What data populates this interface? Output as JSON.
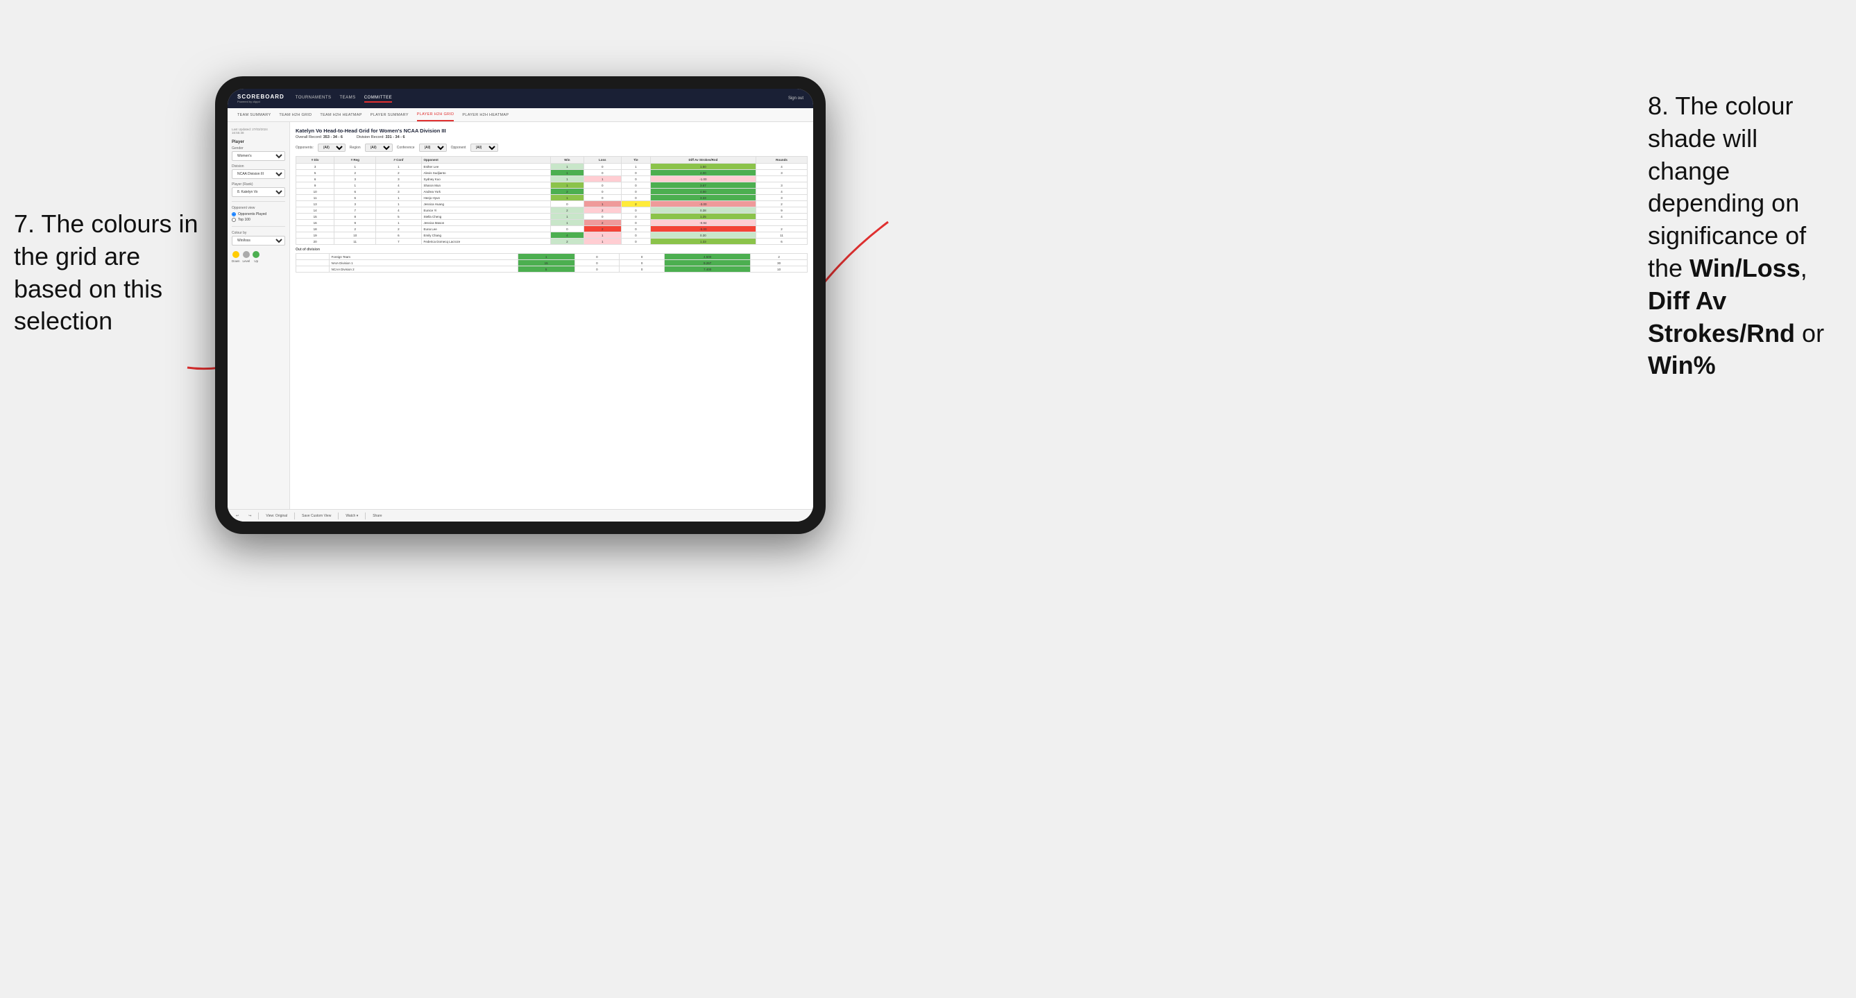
{
  "app": {
    "logo": "SCOREBOARD",
    "logo_sub": "Powered by clippd",
    "nav_links": [
      "TOURNAMENTS",
      "TEAMS",
      "COMMITTEE"
    ],
    "active_nav": "COMMITTEE",
    "sign_out": "Sign out",
    "sub_nav": [
      "TEAM SUMMARY",
      "TEAM H2H GRID",
      "TEAM H2H HEATMAP",
      "PLAYER SUMMARY",
      "PLAYER H2H GRID",
      "PLAYER H2H HEATMAP"
    ],
    "active_sub": "PLAYER H2H GRID"
  },
  "sidebar": {
    "last_updated_label": "Last Updated: 27/03/2024",
    "last_updated_time": "16:55:38",
    "player_section": "Player",
    "gender_label": "Gender",
    "gender_value": "Women's",
    "division_label": "Division",
    "division_value": "NCAA Division III",
    "player_rank_label": "Player (Rank)",
    "player_rank_value": "8. Katelyn Vo",
    "opponent_view_label": "Opponent view",
    "opponents_played_label": "Opponents Played",
    "top_100_label": "Top 100",
    "colour_by_label": "Colour by",
    "colour_by_value": "Win/loss",
    "colour_legend": [
      {
        "label": "Down",
        "color": "#ffcc00"
      },
      {
        "label": "Level",
        "color": "#aaaaaa"
      },
      {
        "label": "Up",
        "color": "#4caf50"
      }
    ]
  },
  "grid": {
    "title": "Katelyn Vo Head-to-Head Grid for Women's NCAA Division III",
    "overall_record_label": "Overall Record:",
    "overall_record": "353 - 34 - 6",
    "division_record_label": "Division Record:",
    "division_record": "331 - 34 - 6",
    "opponents_label": "Opponents:",
    "opponents_value": "(All)",
    "region_label": "Region",
    "conference_label": "Conference",
    "opponent_label": "Opponent",
    "columns": {
      "div": "# Div",
      "reg": "# Reg",
      "conf": "# Conf",
      "opponent": "Opponent",
      "win": "Win",
      "loss": "Loss",
      "tie": "Tie",
      "diff_av": "Diff Av Strokes/Rnd",
      "rounds": "Rounds"
    },
    "rows": [
      {
        "div": 3,
        "reg": 1,
        "conf": 1,
        "opponent": "Esther Lee",
        "win": 1,
        "loss": 0,
        "tie": 1,
        "diff_av": 1.5,
        "rounds": 4,
        "win_color": "green-light",
        "loss_color": "white",
        "tie_color": "white"
      },
      {
        "div": 5,
        "reg": 2,
        "conf": 2,
        "opponent": "Alexis Sudjianto",
        "win": 1,
        "loss": 0,
        "tie": 0,
        "diff_av": 4.0,
        "rounds": 3,
        "win_color": "green-dark",
        "loss_color": "white",
        "tie_color": "white"
      },
      {
        "div": 6,
        "reg": 3,
        "conf": 3,
        "opponent": "Sydney Kuo",
        "win": 1,
        "loss": 1,
        "tie": 0,
        "diff_av": -1.0,
        "rounds": null,
        "win_color": "green-light",
        "loss_color": "red-light",
        "tie_color": "white"
      },
      {
        "div": 9,
        "reg": 1,
        "conf": 4,
        "opponent": "Sharon Mun",
        "win": 1,
        "loss": 0,
        "tie": 0,
        "diff_av": 3.67,
        "rounds": 3,
        "win_color": "green-med",
        "loss_color": "white",
        "tie_color": "white"
      },
      {
        "div": 10,
        "reg": 6,
        "conf": 3,
        "opponent": "Andrea York",
        "win": 2,
        "loss": 0,
        "tie": 0,
        "diff_av": 4.0,
        "rounds": 4,
        "win_color": "green-dark",
        "loss_color": "white",
        "tie_color": "white"
      },
      {
        "div": 11,
        "reg": 6,
        "conf": 1,
        "opponent": "Heejo Hyun",
        "win": 1,
        "loss": 0,
        "tie": 0,
        "diff_av": 3.33,
        "rounds": 3,
        "win_color": "green-med",
        "loss_color": "white",
        "tie_color": "white"
      },
      {
        "div": 13,
        "reg": 3,
        "conf": 1,
        "opponent": "Jessica Huang",
        "win": 0,
        "loss": 1,
        "tie": 2,
        "diff_av": -3.0,
        "rounds": 2,
        "win_color": "white",
        "loss_color": "red-med",
        "tie_color": "yellow"
      },
      {
        "div": 14,
        "reg": 7,
        "conf": 4,
        "opponent": "Eunice Yi",
        "win": 2,
        "loss": 2,
        "tie": 0,
        "diff_av": 0.38,
        "rounds": 9,
        "win_color": "green-light",
        "loss_color": "red-light",
        "tie_color": "white"
      },
      {
        "div": 15,
        "reg": 8,
        "conf": 5,
        "opponent": "Stella Cheng",
        "win": 1,
        "loss": 0,
        "tie": 0,
        "diff_av": 1.25,
        "rounds": 4,
        "win_color": "green-light",
        "loss_color": "white",
        "tie_color": "white"
      },
      {
        "div": 16,
        "reg": 9,
        "conf": 1,
        "opponent": "Jessica Mason",
        "win": 1,
        "loss": 2,
        "tie": 0,
        "diff_av": -0.94,
        "rounds": null,
        "win_color": "green-light",
        "loss_color": "red-med",
        "tie_color": "white"
      },
      {
        "div": 18,
        "reg": 2,
        "conf": 2,
        "opponent": "Euna Lee",
        "win": 0,
        "loss": 2,
        "tie": 0,
        "diff_av": -5.0,
        "rounds": 2,
        "win_color": "white",
        "loss_color": "red-dark",
        "tie_color": "white"
      },
      {
        "div": 19,
        "reg": 10,
        "conf": 6,
        "opponent": "Emily Chang",
        "win": 4,
        "loss": 1,
        "tie": 0,
        "diff_av": 0.3,
        "rounds": 11,
        "win_color": "green-dark",
        "loss_color": "red-light",
        "tie_color": "white"
      },
      {
        "div": 20,
        "reg": 11,
        "conf": 7,
        "opponent": "Federica Domecq Lacroze",
        "win": 2,
        "loss": 1,
        "tie": 0,
        "diff_av": 1.33,
        "rounds": 6,
        "win_color": "green-light",
        "loss_color": "red-light",
        "tie_color": "white"
      }
    ],
    "out_of_division_label": "Out of division",
    "out_of_division_rows": [
      {
        "opponent": "Foreign Team",
        "win": 1,
        "loss": 0,
        "tie": 0,
        "diff_av": 4.5,
        "rounds": 2,
        "win_color": "green-dark",
        "loss_color": "white",
        "tie_color": "white"
      },
      {
        "opponent": "NAIA Division 1",
        "win": 15,
        "loss": 0,
        "tie": 0,
        "diff_av": 9.267,
        "rounds": 30,
        "win_color": "green-dark",
        "loss_color": "white",
        "tie_color": "white"
      },
      {
        "opponent": "NCAA Division 2",
        "win": 5,
        "loss": 0,
        "tie": 0,
        "diff_av": 7.4,
        "rounds": 10,
        "win_color": "green-dark",
        "loss_color": "white",
        "tie_color": "white"
      }
    ]
  },
  "toolbar": {
    "undo": "↩",
    "redo": "↪",
    "view_original": "View: Original",
    "save_custom": "Save Custom View",
    "watch": "Watch ▾",
    "share": "Share"
  },
  "annotations": {
    "left": "7. The colours in the grid are based on this selection",
    "right_intro": "8. The colour shade will change depending on significance of the ",
    "right_bold1": "Win/Loss",
    "right_sep1": ", ",
    "right_bold2": "Diff Av Strokes/Rnd",
    "right_sep2": " or ",
    "right_bold3": "Win%"
  }
}
